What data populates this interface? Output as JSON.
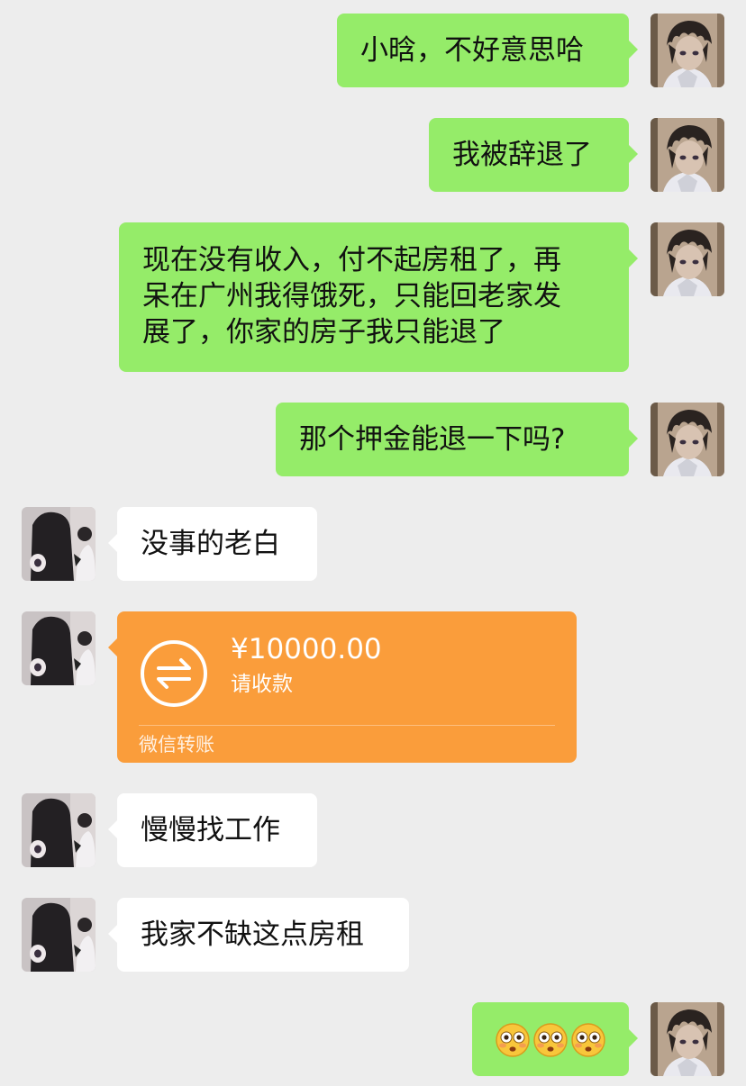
{
  "messages": {
    "m1": {
      "text": "小晗，不好意思哈"
    },
    "m2": {
      "text": "我被辞退了"
    },
    "m3": {
      "lines": [
        "现在没有收入，付不起房租了，再",
        "呆在广州我得饿死，只能回老家发",
        "展了，你家的房子我只能退了"
      ]
    },
    "m4": {
      "text": "那个押金能退一下吗?"
    },
    "m5": {
      "text": "没事的老白"
    },
    "m6": {
      "amount": "¥10000.00",
      "status": "请收款",
      "footer": "微信转账"
    },
    "m7": {
      "text": "慢慢找工作"
    },
    "m8": {
      "text": "我家不缺这点房租"
    },
    "m9": {
      "emoji": [
        "flushed-face-emoji",
        "flushed-face-emoji",
        "flushed-face-emoji"
      ]
    }
  },
  "colors": {
    "background": "#ededed",
    "my_bubble": "#95ec69",
    "their_bubble": "#ffffff",
    "transfer_card": "#fa9d3b"
  },
  "icons": {
    "transfer": "transfer-arrows-icon",
    "my_avatar": "avatar-dark-hair-boy",
    "their_avatar": "avatar-long-hair-girl"
  }
}
